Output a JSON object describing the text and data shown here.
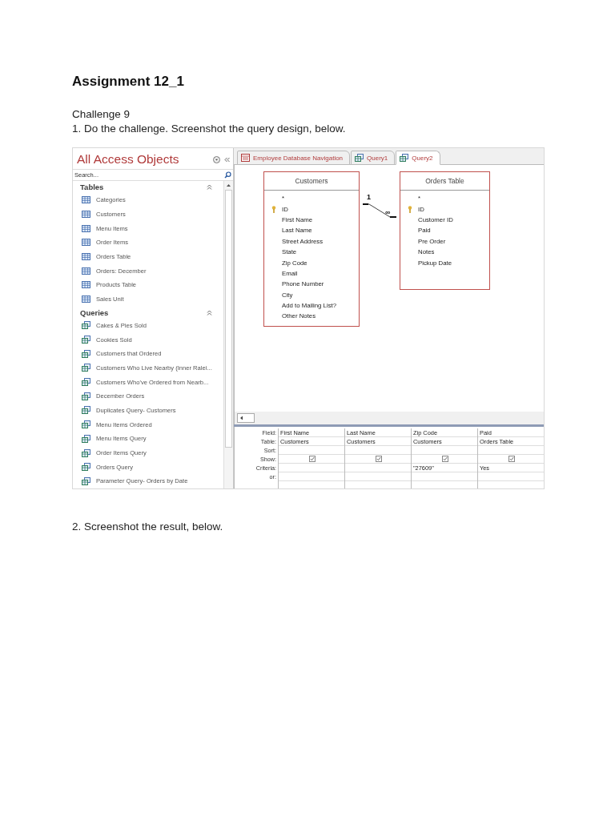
{
  "heading": "Assignment 12_1",
  "subheading": "Challenge 9",
  "step_1": "1.  Do the challenge. Screenshot the query design, below.",
  "navigation_pane": {
    "title": "All Access Objects",
    "search": {
      "placeholder": "Search..."
    },
    "groups": [
      {
        "kind": "table",
        "label": "Tables",
        "items": [
          "Categories",
          "Customers",
          "Menu Items",
          "Order Items",
          "Orders Table",
          "Orders: December",
          "Products Table",
          "Sales Unit"
        ]
      },
      {
        "kind": "query",
        "label": "Queries",
        "items": [
          "Cakes & Pies Sold",
          "Cookies Sold",
          "Customers that Ordered",
          "Customers Who Live Nearby (Inner Ralei...",
          "Customers Who've Ordered from Nearb...",
          "December Orders",
          "Duplicates Query- Customers",
          "Menu Items Ordered",
          "Menu Items Query",
          "Order Items Query",
          "Orders Query",
          "Parameter Query- Orders by Date"
        ]
      }
    ]
  },
  "tabs": [
    {
      "kind": "form",
      "label": "Employee Database Navigation",
      "selected": false
    },
    {
      "kind": "query",
      "label": "Query1",
      "selected": false
    },
    {
      "kind": "query",
      "label": "Query2",
      "selected": true
    }
  ],
  "field_lists": [
    {
      "title": "Customers",
      "fields": [
        {
          "name": "*",
          "key": false
        },
        {
          "name": "ID",
          "key": true
        },
        {
          "name": "First Name",
          "key": false
        },
        {
          "name": "Last Name",
          "key": false
        },
        {
          "name": "Street Address",
          "key": false
        },
        {
          "name": "State",
          "key": false
        },
        {
          "name": "Zip Code",
          "key": false
        },
        {
          "name": "Email",
          "key": false
        },
        {
          "name": "Phone Number",
          "key": false
        },
        {
          "name": "City",
          "key": false
        },
        {
          "name": "Add to Mailing List?",
          "key": false
        },
        {
          "name": "Other Notes",
          "key": false
        }
      ]
    },
    {
      "title": "Orders Table",
      "fields": [
        {
          "name": "*",
          "key": false
        },
        {
          "name": "ID",
          "key": true
        },
        {
          "name": "Customer ID",
          "key": false
        },
        {
          "name": "Paid",
          "key": false
        },
        {
          "name": "Pre Order",
          "key": false
        },
        {
          "name": "Notes",
          "key": false
        },
        {
          "name": "Pickup Date",
          "key": false
        }
      ]
    }
  ],
  "relationship": {
    "one_label": "1",
    "many_label": "∞"
  },
  "query_grid": {
    "row_labels": [
      "Field:",
      "Table:",
      "Sort:",
      "Show:",
      "Criteria:",
      "or:"
    ],
    "columns": [
      {
        "field": "First Name",
        "table": "Customers",
        "show": true
      },
      {
        "field": "Last Name",
        "table": "Customers",
        "show": true
      },
      {
        "field": "Zip Code",
        "table": "Customers",
        "show": true,
        "criteria": "\"27609\""
      },
      {
        "field": "Paid",
        "table": "Orders Table",
        "show": true,
        "criteria": "Yes"
      }
    ]
  },
  "step_2": "2.  Screenshot the result, below."
}
